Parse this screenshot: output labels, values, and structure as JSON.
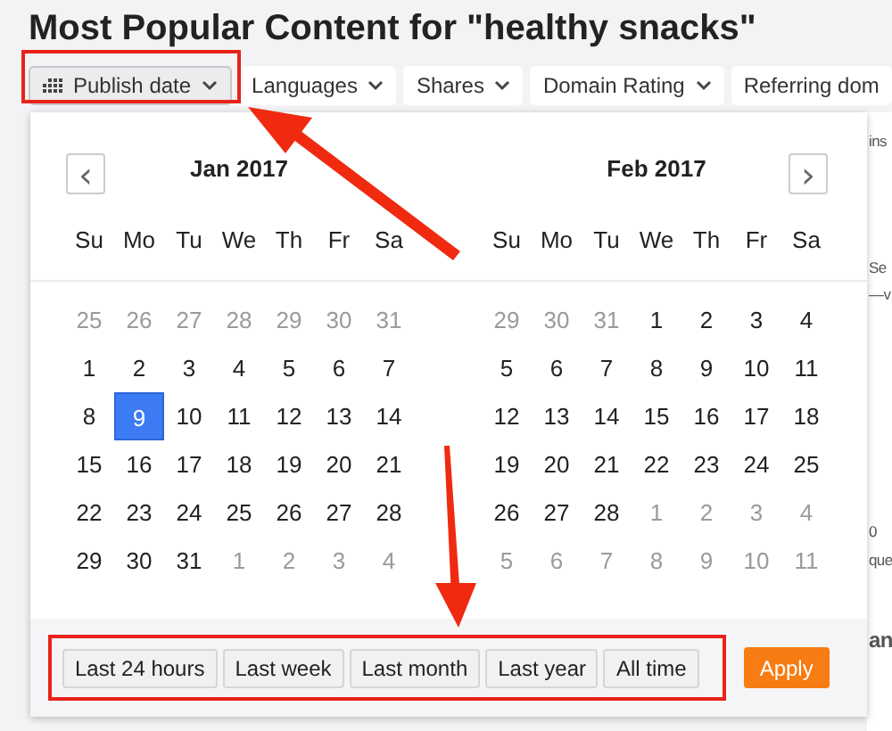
{
  "title": "Most Popular Content for \"healthy snacks\"",
  "filters": [
    {
      "label": "Publish date",
      "selected": true
    },
    {
      "label": "Languages",
      "selected": false
    },
    {
      "label": "Shares",
      "selected": false
    },
    {
      "label": "Domain Rating",
      "selected": false
    },
    {
      "label": "Referring dom",
      "selected": false
    }
  ],
  "background_fragments": [
    "ins",
    "Se",
    "—v",
    "0",
    "que",
    "an"
  ],
  "date_picker": {
    "prev": "‹",
    "next": "›",
    "months": [
      {
        "title": "Jan 2017",
        "weekdays": [
          "Su",
          "Mo",
          "Tu",
          "We",
          "Th",
          "Fr",
          "Sa"
        ],
        "weeks": [
          [
            {
              "day": "25",
              "muted": true,
              "selected": false
            },
            {
              "day": "26",
              "muted": true,
              "selected": false
            },
            {
              "day": "27",
              "muted": true,
              "selected": false
            },
            {
              "day": "28",
              "muted": true,
              "selected": false
            },
            {
              "day": "29",
              "muted": true,
              "selected": false
            },
            {
              "day": "30",
              "muted": true,
              "selected": false
            },
            {
              "day": "31",
              "muted": true,
              "selected": false
            }
          ],
          [
            {
              "day": "1",
              "muted": false,
              "selected": false
            },
            {
              "day": "2",
              "muted": false,
              "selected": false
            },
            {
              "day": "3",
              "muted": false,
              "selected": false
            },
            {
              "day": "4",
              "muted": false,
              "selected": false
            },
            {
              "day": "5",
              "muted": false,
              "selected": false
            },
            {
              "day": "6",
              "muted": false,
              "selected": false
            },
            {
              "day": "7",
              "muted": false,
              "selected": false
            }
          ],
          [
            {
              "day": "8",
              "muted": false,
              "selected": false
            },
            {
              "day": "9",
              "muted": false,
              "selected": true
            },
            {
              "day": "10",
              "muted": false,
              "selected": false
            },
            {
              "day": "11",
              "muted": false,
              "selected": false
            },
            {
              "day": "12",
              "muted": false,
              "selected": false
            },
            {
              "day": "13",
              "muted": false,
              "selected": false
            },
            {
              "day": "14",
              "muted": false,
              "selected": false
            }
          ],
          [
            {
              "day": "15",
              "muted": false,
              "selected": false
            },
            {
              "day": "16",
              "muted": false,
              "selected": false
            },
            {
              "day": "17",
              "muted": false,
              "selected": false
            },
            {
              "day": "18",
              "muted": false,
              "selected": false
            },
            {
              "day": "19",
              "muted": false,
              "selected": false
            },
            {
              "day": "20",
              "muted": false,
              "selected": false
            },
            {
              "day": "21",
              "muted": false,
              "selected": false
            }
          ],
          [
            {
              "day": "22",
              "muted": false,
              "selected": false
            },
            {
              "day": "23",
              "muted": false,
              "selected": false
            },
            {
              "day": "24",
              "muted": false,
              "selected": false
            },
            {
              "day": "25",
              "muted": false,
              "selected": false
            },
            {
              "day": "26",
              "muted": false,
              "selected": false
            },
            {
              "day": "27",
              "muted": false,
              "selected": false
            },
            {
              "day": "28",
              "muted": false,
              "selected": false
            }
          ],
          [
            {
              "day": "29",
              "muted": false,
              "selected": false
            },
            {
              "day": "30",
              "muted": false,
              "selected": false
            },
            {
              "day": "31",
              "muted": false,
              "selected": false
            },
            {
              "day": "1",
              "muted": true,
              "selected": false
            },
            {
              "day": "2",
              "muted": true,
              "selected": false
            },
            {
              "day": "3",
              "muted": true,
              "selected": false
            },
            {
              "day": "4",
              "muted": true,
              "selected": false
            }
          ]
        ]
      },
      {
        "title": "Feb 2017",
        "weekdays": [
          "Su",
          "Mo",
          "Tu",
          "We",
          "Th",
          "Fr",
          "Sa"
        ],
        "weeks": [
          [
            {
              "day": "29",
              "muted": true,
              "selected": false
            },
            {
              "day": "30",
              "muted": true,
              "selected": false
            },
            {
              "day": "31",
              "muted": true,
              "selected": false
            },
            {
              "day": "1",
              "muted": false,
              "selected": false
            },
            {
              "day": "2",
              "muted": false,
              "selected": false
            },
            {
              "day": "3",
              "muted": false,
              "selected": false
            },
            {
              "day": "4",
              "muted": false,
              "selected": false
            }
          ],
          [
            {
              "day": "5",
              "muted": false,
              "selected": false
            },
            {
              "day": "6",
              "muted": false,
              "selected": false
            },
            {
              "day": "7",
              "muted": false,
              "selected": false
            },
            {
              "day": "8",
              "muted": false,
              "selected": false
            },
            {
              "day": "9",
              "muted": false,
              "selected": false
            },
            {
              "day": "10",
              "muted": false,
              "selected": false
            },
            {
              "day": "11",
              "muted": false,
              "selected": false
            }
          ],
          [
            {
              "day": "12",
              "muted": false,
              "selected": false
            },
            {
              "day": "13",
              "muted": false,
              "selected": false
            },
            {
              "day": "14",
              "muted": false,
              "selected": false
            },
            {
              "day": "15",
              "muted": false,
              "selected": false
            },
            {
              "day": "16",
              "muted": false,
              "selected": false
            },
            {
              "day": "17",
              "muted": false,
              "selected": false
            },
            {
              "day": "18",
              "muted": false,
              "selected": false
            }
          ],
          [
            {
              "day": "19",
              "muted": false,
              "selected": false
            },
            {
              "day": "20",
              "muted": false,
              "selected": false
            },
            {
              "day": "21",
              "muted": false,
              "selected": false
            },
            {
              "day": "22",
              "muted": false,
              "selected": false
            },
            {
              "day": "23",
              "muted": false,
              "selected": false
            },
            {
              "day": "24",
              "muted": false,
              "selected": false
            },
            {
              "day": "25",
              "muted": false,
              "selected": false
            }
          ],
          [
            {
              "day": "26",
              "muted": false,
              "selected": false
            },
            {
              "day": "27",
              "muted": false,
              "selected": false
            },
            {
              "day": "28",
              "muted": false,
              "selected": false
            },
            {
              "day": "1",
              "muted": true,
              "selected": false
            },
            {
              "day": "2",
              "muted": true,
              "selected": false
            },
            {
              "day": "3",
              "muted": true,
              "selected": false
            },
            {
              "day": "4",
              "muted": true,
              "selected": false
            }
          ],
          [
            {
              "day": "5",
              "muted": true,
              "selected": false
            },
            {
              "day": "6",
              "muted": true,
              "selected": false
            },
            {
              "day": "7",
              "muted": true,
              "selected": false
            },
            {
              "day": "8",
              "muted": true,
              "selected": false
            },
            {
              "day": "9",
              "muted": true,
              "selected": false
            },
            {
              "day": "10",
              "muted": true,
              "selected": false
            },
            {
              "day": "11",
              "muted": true,
              "selected": false
            }
          ]
        ]
      }
    ],
    "presets": [
      "Last 24 hours",
      "Last week",
      "Last month",
      "Last year",
      "All time"
    ],
    "apply": "Apply"
  }
}
